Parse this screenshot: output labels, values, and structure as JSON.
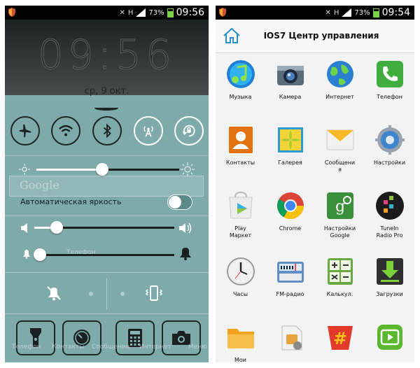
{
  "left": {
    "status": {
      "battery": "73%",
      "time": "09:56"
    },
    "lock_time": "09:56",
    "lock_date": "ср, 9 окт.",
    "google_hint": "Google",
    "auto_brightness_label": "Автоматическая яркость",
    "ghost_labels": [
      "Телефон",
      "Контакты",
      "Сообщения",
      "Интернет",
      "Меню"
    ],
    "brightness_level": 0.46,
    "media_volume_level": 0.16,
    "ringer_volume_level": 0.04,
    "auto_brightness_on": false
  },
  "right": {
    "status": {
      "battery": "73%",
      "time": "09:54"
    },
    "title": "IOS7 Центр управления",
    "apps": [
      {
        "label": "Музыка",
        "icon": "music-icon"
      },
      {
        "label": "Камера",
        "icon": "camera-icon"
      },
      {
        "label": "Интернет",
        "icon": "globe-icon"
      },
      {
        "label": "Телефон",
        "icon": "phone-icon"
      },
      {
        "label": "Контакты",
        "icon": "contacts-icon"
      },
      {
        "label": "Галерея",
        "icon": "gallery-icon"
      },
      {
        "label": "Сообщени\nя",
        "icon": "messages-icon"
      },
      {
        "label": "Настройки",
        "icon": "settings-gear-icon"
      },
      {
        "label": "Play\nМаркет",
        "icon": "play-store-icon"
      },
      {
        "label": "Chrome",
        "icon": "chrome-icon"
      },
      {
        "label": "Настройки\nGoogle",
        "icon": "google-settings-icon"
      },
      {
        "label": "TuneIn\nRadio Pro",
        "icon": "tunein-icon"
      },
      {
        "label": "Часы",
        "icon": "clock-icon"
      },
      {
        "label": "FM-радио",
        "icon": "fm-radio-icon"
      },
      {
        "label": "Калькул.",
        "icon": "calculator-icon"
      },
      {
        "label": "Загрузки",
        "icon": "downloads-icon"
      },
      {
        "label": "Мои",
        "icon": "folder-icon"
      },
      {
        "label": "",
        "icon": "sim-toolkit-icon"
      },
      {
        "label": "",
        "icon": "superuser-icon"
      },
      {
        "label": "",
        "icon": "video-player-icon"
      }
    ]
  },
  "colors": {
    "control_center": "#84b5b4",
    "status_bar": "#000000",
    "battery": "#7cd14a",
    "drawer_bg": "#f3f3f3"
  }
}
